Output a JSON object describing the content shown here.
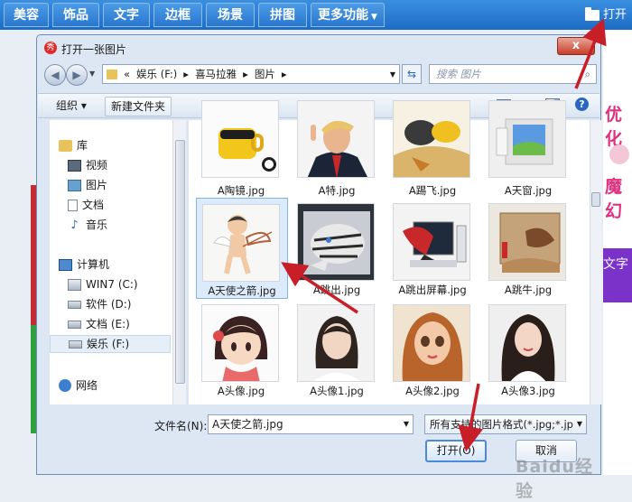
{
  "app_toolbar": {
    "tabs": [
      "美容",
      "饰品",
      "文字",
      "边框",
      "场景",
      "拼图",
      "更多功能"
    ],
    "open_label": "打开"
  },
  "background": {
    "right_text_1": "优化",
    "right_text_2": "魔幻",
    "right_text_3": "文字"
  },
  "dialog": {
    "title": "打开一张图片",
    "close_glyph": "x",
    "logo_glyph": "秀",
    "breadcrumb": [
      "«",
      "娱乐 (F:)",
      "▸",
      "喜马拉雅",
      "▸",
      "图片",
      "▸"
    ],
    "search_placeholder": "搜索 图片",
    "toolbar": {
      "organize": "组织 ▾",
      "new_folder": "新建文件夹"
    },
    "nav": {
      "library": "库",
      "library_items": [
        "视频",
        "图片",
        "文档",
        "音乐"
      ],
      "computer": "计算机",
      "drives": [
        "WIN7 (C:)",
        "软件 (D:)",
        "文档 (E:)",
        "娱乐 (F:)"
      ],
      "network": "网络"
    },
    "files": [
      {
        "name": "A陶镜.jpg"
      },
      {
        "name": "A特.jpg"
      },
      {
        "name": "A踢飞.jpg"
      },
      {
        "name": "A天窗.jpg"
      },
      {
        "name": "A天使之箭.jpg",
        "selected": true
      },
      {
        "name": "A跳出.jpg"
      },
      {
        "name": "A跳出屏幕.jpg"
      },
      {
        "name": "A跳牛.jpg"
      },
      {
        "name": "A头像.jpg"
      },
      {
        "name": "A头像1.jpg"
      },
      {
        "name": "A头像2.jpg"
      },
      {
        "name": "A头像3.jpg"
      }
    ],
    "filename_label": "文件名(N):",
    "filename_value": "A天使之箭.jpg",
    "filetype_value": "所有支持的图片格式(*.jpg;*.jp",
    "open_button": "打开(O)",
    "cancel_button": "取消"
  },
  "watermark": "Baidu经验",
  "colors": {
    "toolbar_blue": "#1d6cc4",
    "arrow_red": "#c81e28",
    "selection_blue": "#dcebfc"
  }
}
